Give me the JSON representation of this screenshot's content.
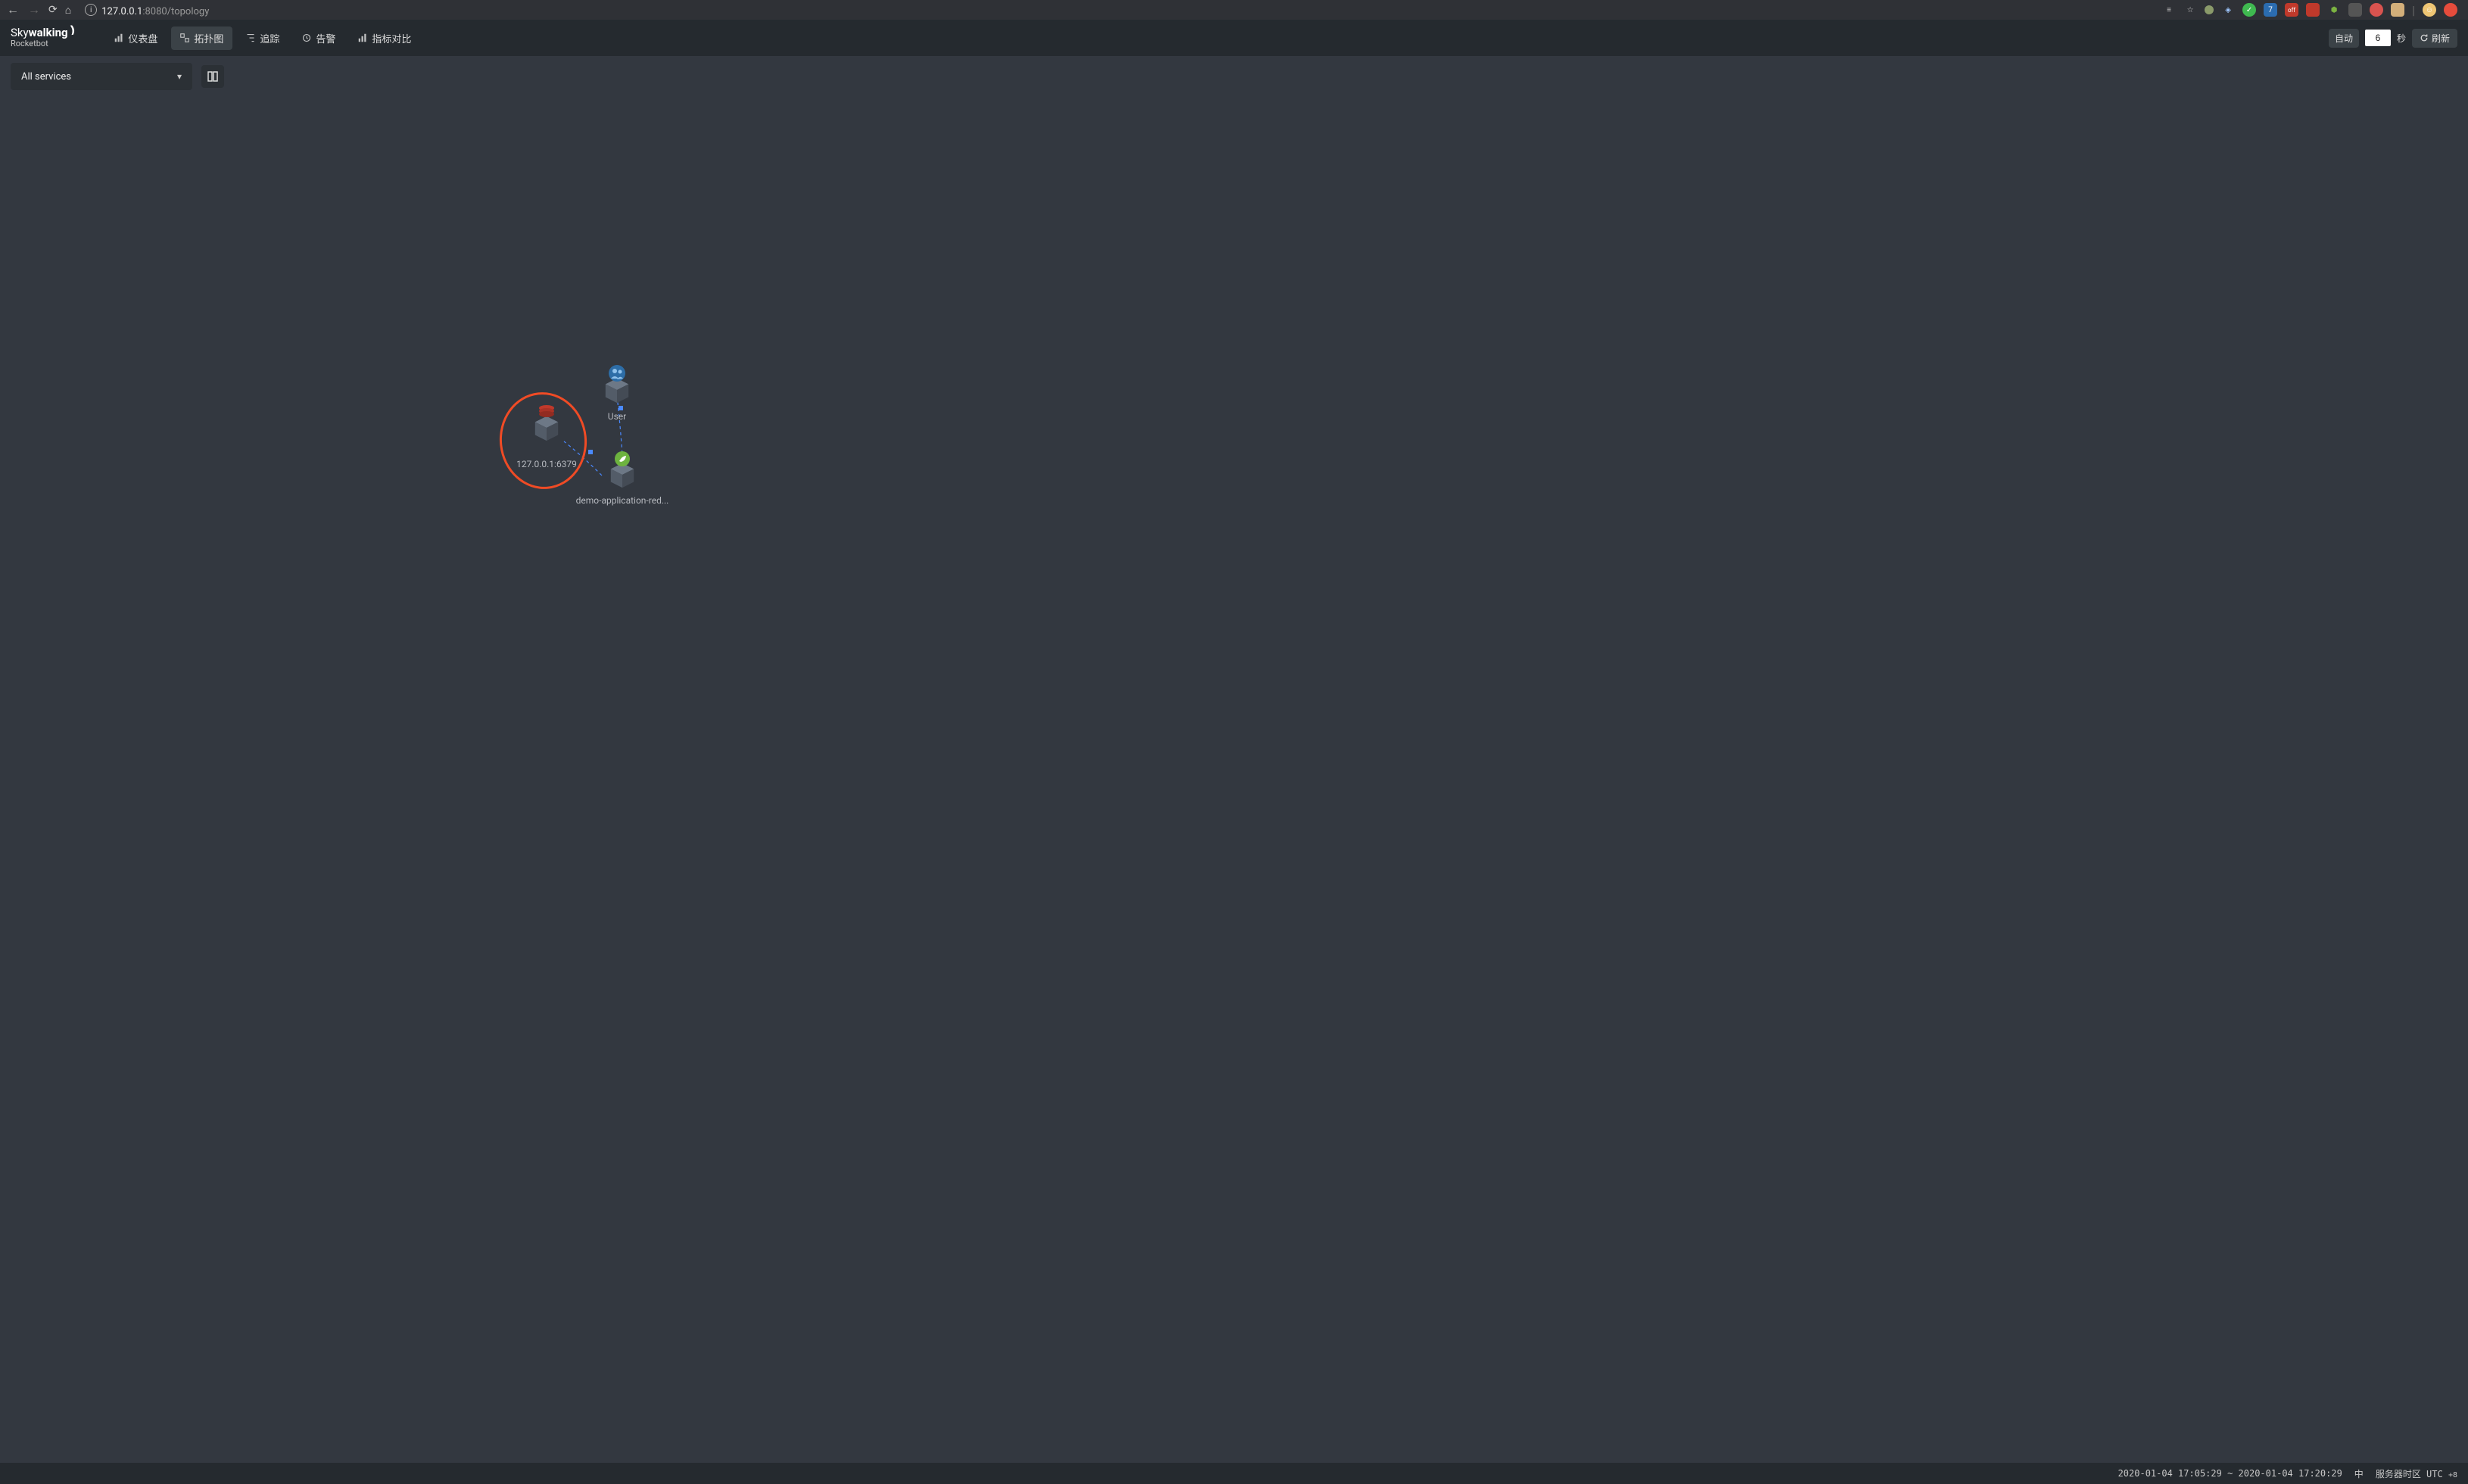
{
  "browser": {
    "url_host": "127.0.0.1",
    "url_rest": ":8080/topology"
  },
  "logo": {
    "line1_prefix": "Sky",
    "line1_bold": "walking",
    "line2": "Rocketbot"
  },
  "nav": {
    "dashboard": "仪表盘",
    "topology": "拓扑图",
    "trace": "追踪",
    "alarm": "告警",
    "compare": "指标对比"
  },
  "header_right": {
    "auto": "自动",
    "interval": "6",
    "sec": "秒",
    "refresh": "刷新"
  },
  "toolbar": {
    "service_select": "All services"
  },
  "nodes": {
    "redis_label": "127.0.0.1:6379",
    "user_label": "User",
    "app_label": "demo-application-red..."
  },
  "footer": {
    "time_range": "2020-01-04 17:05:29 ~ 2020-01-04 17:20:29",
    "lang": "中",
    "tz_label": "服务器时区 UTC",
    "tz_offset": "+8"
  }
}
